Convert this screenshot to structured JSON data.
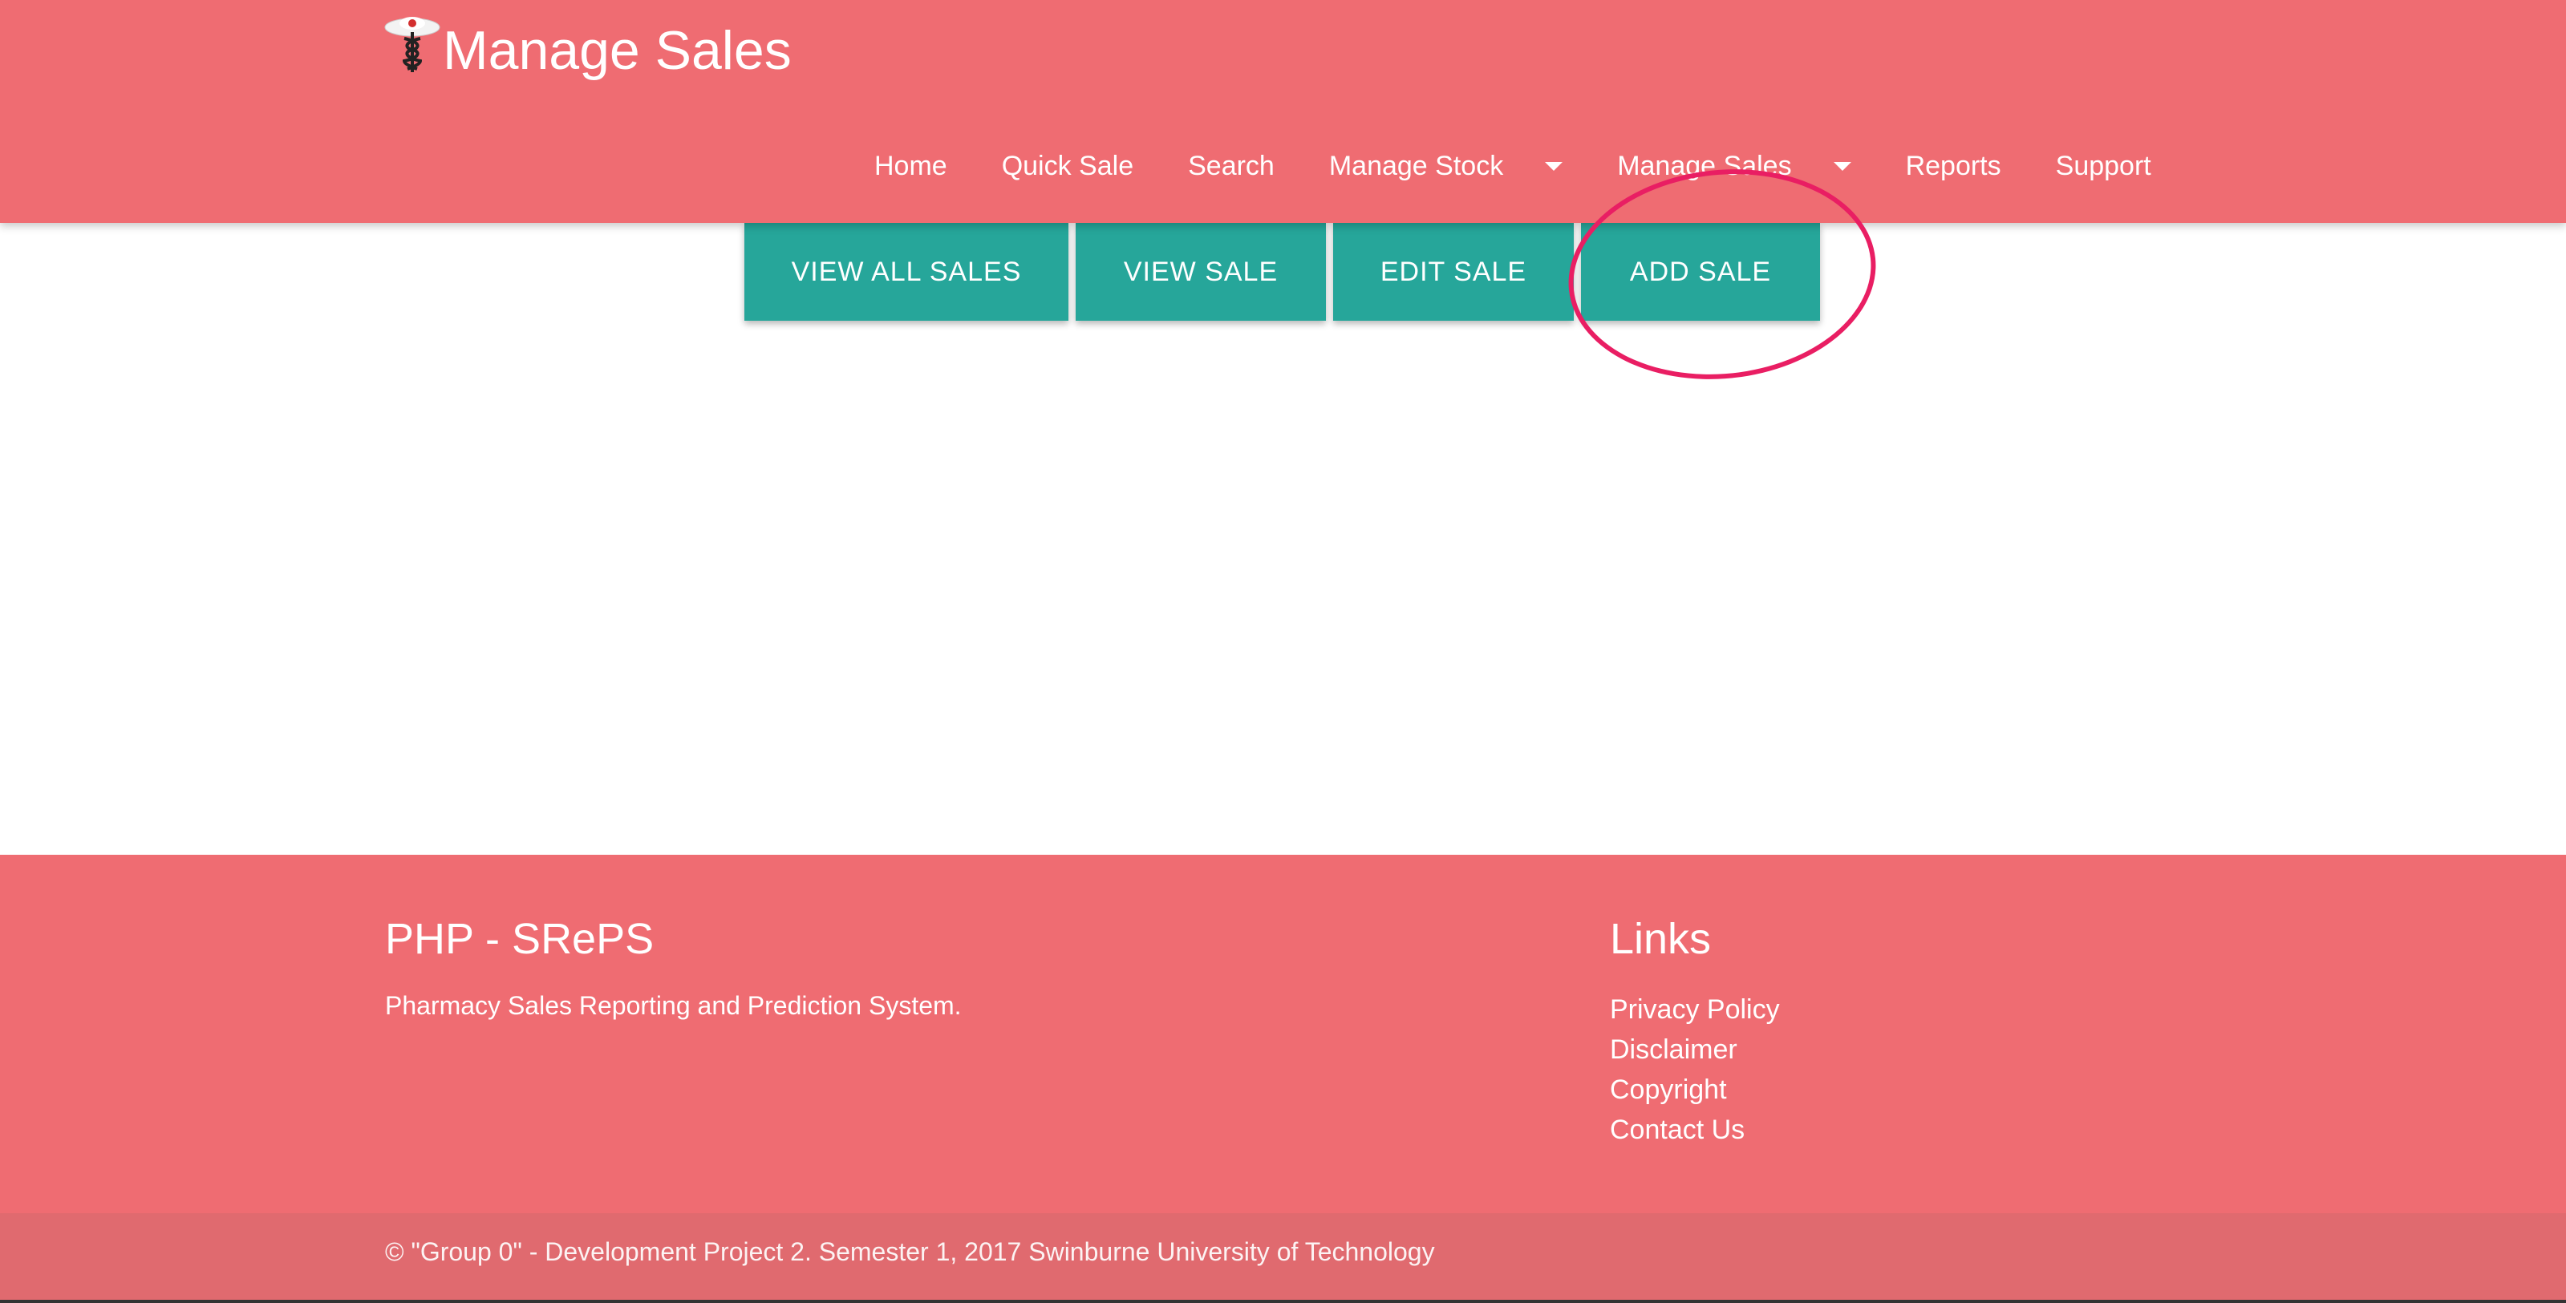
{
  "colors": {
    "brand": "#ef6c72",
    "accent": "#26a69a",
    "ring": "#e91e63",
    "copybar": "#e06a6f"
  },
  "header": {
    "title": "Manage Sales",
    "logo_icon": "caduceus-pharmacy-icon"
  },
  "nav": {
    "items": [
      {
        "label": "Home"
      },
      {
        "label": "Quick Sale"
      },
      {
        "label": "Search"
      },
      {
        "label": "Manage Stock",
        "dropdown": true
      },
      {
        "label": "Manage Sales",
        "dropdown": true
      },
      {
        "label": "Reports"
      },
      {
        "label": "Support"
      }
    ]
  },
  "actions": {
    "buttons": [
      {
        "label": "VIEW ALL SALES"
      },
      {
        "label": "VIEW SALE"
      },
      {
        "label": "EDIT SALE"
      },
      {
        "label": "ADD SALE",
        "highlighted": true
      }
    ]
  },
  "footer": {
    "brand_title": "PHP - SRePS",
    "description": "Pharmacy Sales Reporting and Prediction System.",
    "links_title": "Links",
    "links": [
      {
        "label": "Privacy Policy"
      },
      {
        "label": "Disclaimer"
      },
      {
        "label": "Copyright"
      },
      {
        "label": "Contact Us"
      }
    ],
    "copyright": "© \"Group 0\" - Development Project 2. Semester 1, 2017 Swinburne University of Technology"
  }
}
